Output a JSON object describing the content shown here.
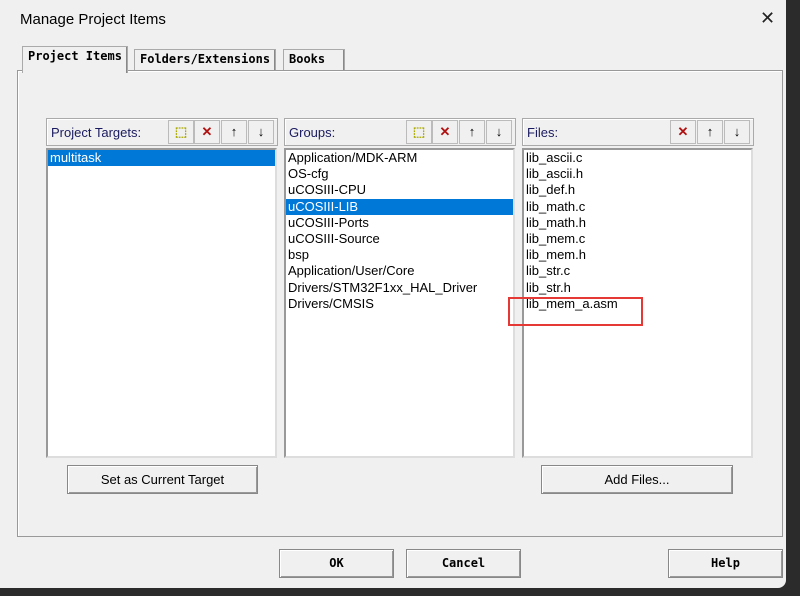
{
  "window": {
    "title": "Manage Project Items",
    "close_icon": "close-icon"
  },
  "tabs": [
    {
      "label": "Project Items"
    },
    {
      "label": "Folders/Extensions"
    },
    {
      "label": "Books"
    }
  ],
  "targets": {
    "label": "Project Targets:",
    "items": [
      "multitask"
    ],
    "selected": "multitask"
  },
  "groups": {
    "label": "Groups:",
    "items": [
      "Application/MDK-ARM",
      "OS-cfg",
      "uCOSIII-CPU",
      "uCOSIII-LIB",
      "uCOSIII-Ports",
      "uCOSIII-Source",
      "bsp",
      "Application/User/Core",
      "Drivers/STM32F1xx_HAL_Driver",
      "Drivers/CMSIS"
    ],
    "selected": "uCOSIII-LIB"
  },
  "files": {
    "label": "Files:",
    "items": [
      "lib_ascii.c",
      "lib_ascii.h",
      "lib_def.h",
      "lib_math.c",
      "lib_math.h",
      "lib_mem.c",
      "lib_mem.h",
      "lib_str.c",
      "lib_str.h",
      "lib_mem_a.asm"
    ],
    "highlighted": "lib_mem_a.asm"
  },
  "buttons": {
    "set_target": "Set as Current Target",
    "add_files": "Add Files...",
    "ok": "OK",
    "cancel": "Cancel",
    "help": "Help"
  },
  "icons": {
    "new": "✧",
    "delete": "✕",
    "up": "🡅",
    "down": "🡇"
  },
  "colors": {
    "selection": "#0078d7",
    "highlight_box": "#e53935",
    "delete": "#b01010"
  }
}
